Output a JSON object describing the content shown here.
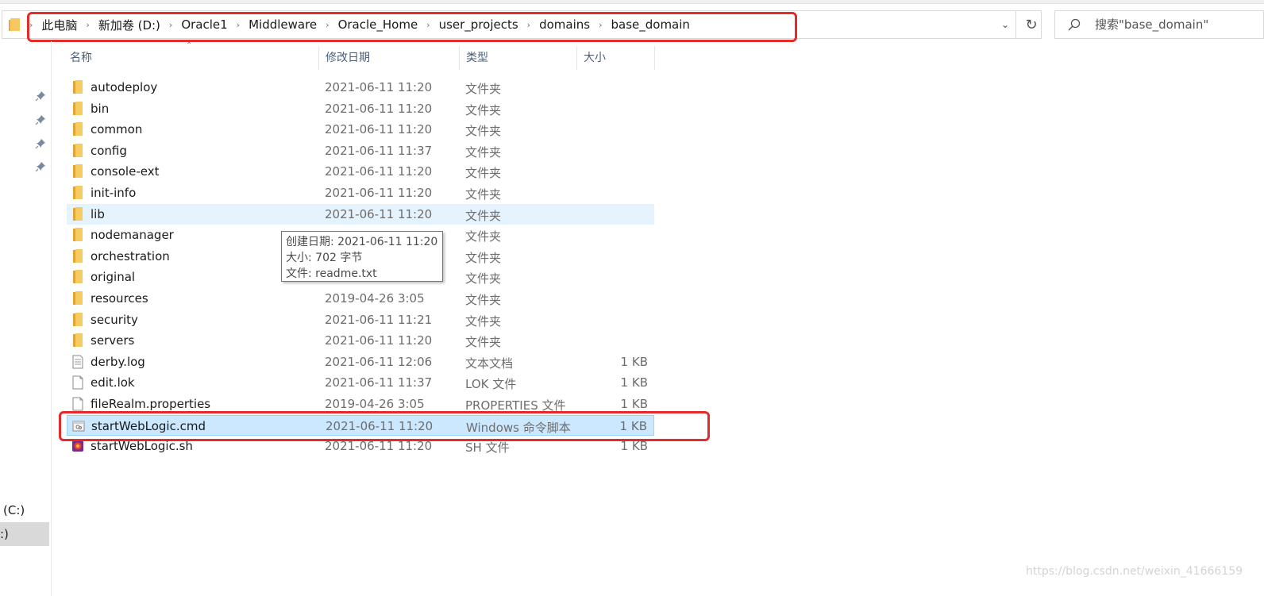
{
  "address_bar": {
    "crumbs": [
      "此电脑",
      "新加卷 (D:)",
      "Oracle1",
      "Middleware",
      "Oracle_Home",
      "user_projects",
      "domains",
      "base_domain"
    ]
  },
  "search": {
    "placeholder": "搜索\"base_domain\""
  },
  "nav_pane": {
    "drive_c": "(C:)",
    "drive_d": ":)"
  },
  "columns": {
    "name": "名称",
    "date": "修改日期",
    "type": "类型",
    "size": "大小"
  },
  "files": [
    {
      "name": "autodeploy",
      "date": "2021-06-11 11:20",
      "type": "文件夹",
      "size": "",
      "icon": "folder-icon"
    },
    {
      "name": "bin",
      "date": "2021-06-11 11:20",
      "type": "文件夹",
      "size": "",
      "icon": "folder-icon"
    },
    {
      "name": "common",
      "date": "2021-06-11 11:20",
      "type": "文件夹",
      "size": "",
      "icon": "folder-icon"
    },
    {
      "name": "config",
      "date": "2021-06-11 11:37",
      "type": "文件夹",
      "size": "",
      "icon": "folder-icon"
    },
    {
      "name": "console-ext",
      "date": "2021-06-11 11:20",
      "type": "文件夹",
      "size": "",
      "icon": "folder-icon"
    },
    {
      "name": "init-info",
      "date": "2021-06-11 11:20",
      "type": "文件夹",
      "size": "",
      "icon": "folder-icon"
    },
    {
      "name": "lib",
      "date": "2021-06-11 11:20",
      "type": "文件夹",
      "size": "",
      "icon": "folder-icon",
      "state": "hover"
    },
    {
      "name": "nodemanager",
      "date": "",
      "type": "文件夹",
      "size": "",
      "icon": "folder-icon"
    },
    {
      "name": "orchestration",
      "date": "",
      "type": "文件夹",
      "size": "",
      "icon": "folder-icon"
    },
    {
      "name": "original",
      "date": "",
      "type": "文件夹",
      "size": "",
      "icon": "folder-icon"
    },
    {
      "name": "resources",
      "date": "2019-04-26 3:05",
      "type": "文件夹",
      "size": "",
      "icon": "folder-icon"
    },
    {
      "name": "security",
      "date": "2021-06-11 11:21",
      "type": "文件夹",
      "size": "",
      "icon": "folder-icon"
    },
    {
      "name": "servers",
      "date": "2021-06-11 11:20",
      "type": "文件夹",
      "size": "",
      "icon": "folder-icon"
    },
    {
      "name": "derby.log",
      "date": "2021-06-11 12:06",
      "type": "文本文档",
      "size": "1 KB",
      "icon": "text-file-icon"
    },
    {
      "name": "edit.lok",
      "date": "2021-06-11 11:37",
      "type": "LOK 文件",
      "size": "1 KB",
      "icon": "file-icon"
    },
    {
      "name": "fileRealm.properties",
      "date": "2019-04-26 3:05",
      "type": "PROPERTIES 文件",
      "size": "1 KB",
      "icon": "file-icon"
    },
    {
      "name": "startWebLogic.cmd",
      "date": "2021-06-11 11:20",
      "type": "Windows 命令脚本",
      "size": "1 KB",
      "icon": "cmd-script-icon",
      "state": "selected"
    },
    {
      "name": "startWebLogic.sh",
      "date": "2021-06-11 11:20",
      "type": "SH 文件",
      "size": "1 KB",
      "icon": "sh-script-icon"
    }
  ],
  "tooltip": {
    "created": "创建日期: 2021-06-11 11:20",
    "size": "大小: 702 字节",
    "file": "文件: readme.txt"
  },
  "watermark": "https://blog.csdn.net/weixin_41666159",
  "colors": {
    "highlight_box": "#e52a2a",
    "selection": "#cce8ff",
    "hover": "#e5f3ff",
    "folder": "#f2c55c"
  }
}
